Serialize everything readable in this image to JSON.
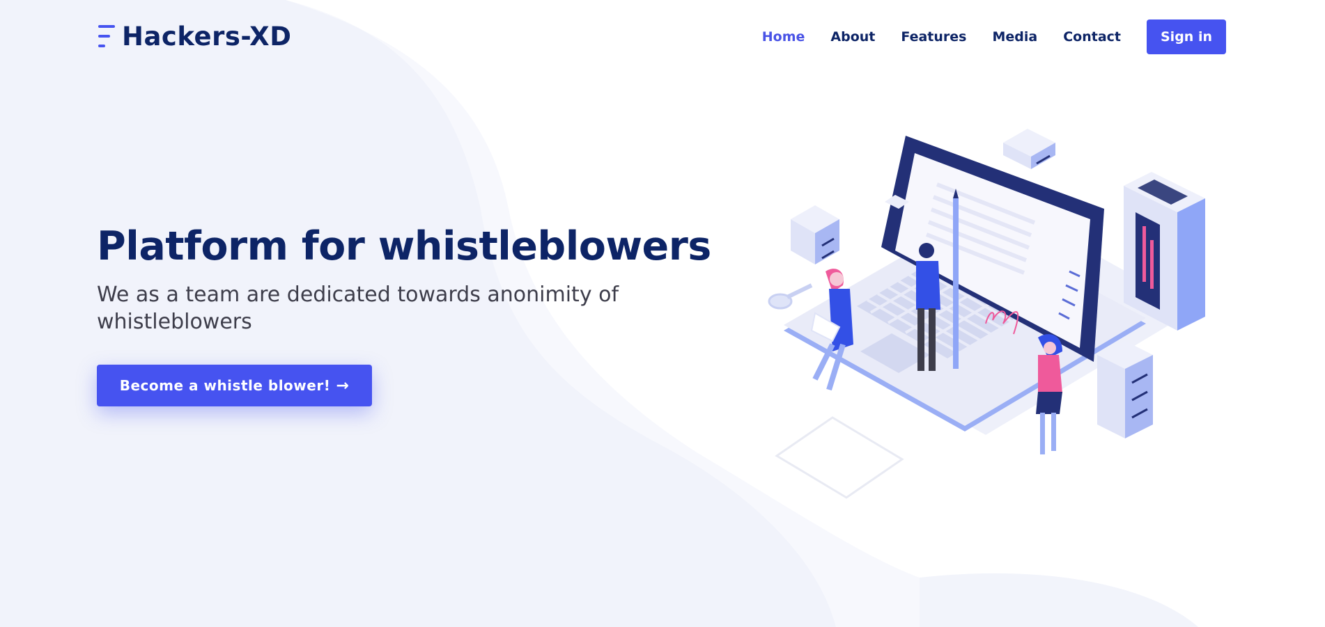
{
  "brand": {
    "name": "Hackers-XD",
    "logo_icon": "menu-lines-icon",
    "accent_color": "#4653f0",
    "text_color": "#0d2466"
  },
  "nav": {
    "items": [
      {
        "label": "Home",
        "active": true
      },
      {
        "label": "About",
        "active": false
      },
      {
        "label": "Features",
        "active": false
      },
      {
        "label": "Media",
        "active": false
      },
      {
        "label": "Contact",
        "active": false
      }
    ],
    "signin_label": "Sign in"
  },
  "hero": {
    "title": "Platform for whistleblowers",
    "subtitle": "We as a team are dedicated towards anonimity of whistleblowers",
    "cta_label": "Become a whistle blower!",
    "cta_icon": "arrow-right-icon"
  },
  "illustration": {
    "name": "isometric-laptop-team-illustration"
  }
}
